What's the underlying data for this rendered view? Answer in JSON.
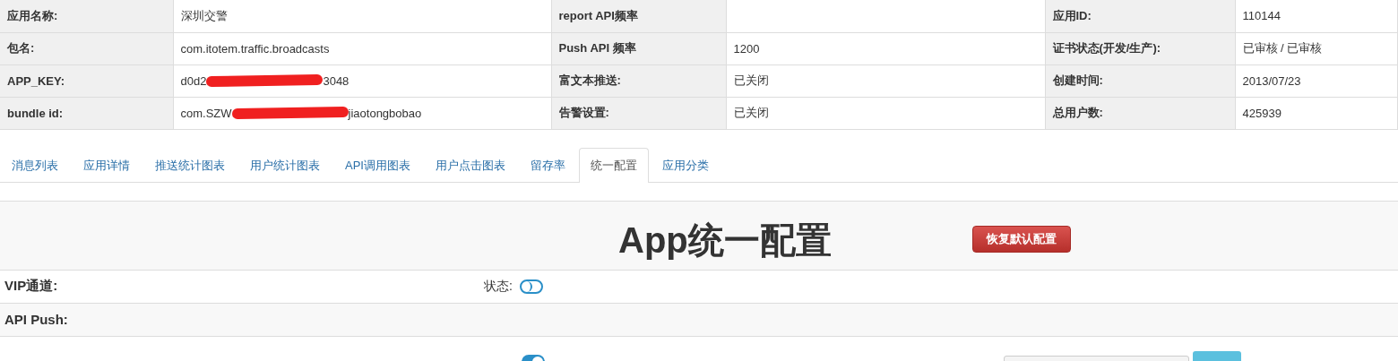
{
  "info_table": {
    "rows": [
      {
        "cells": [
          {
            "label": "应用名称:",
            "value": "深圳交警"
          },
          {
            "label": "report API频率"
          },
          {
            "label": "应用ID:",
            "value": "110144"
          }
        ]
      },
      {
        "cells": [
          {
            "label": "包名:",
            "value": "com.itotem.traffic.broadcasts"
          },
          {
            "label": "Push API 频率",
            "value": "1200"
          },
          {
            "label": "证书状态(开发/生产):",
            "value": "已审核 / 已审核"
          }
        ]
      },
      {
        "cells": [
          {
            "label": "APP_KEY:",
            "value": "d0d2",
            "value_end": "3048",
            "redacted": true
          },
          {
            "label": "富文本推送:",
            "value": "已关闭"
          },
          {
            "label": "创建时间:",
            "value": "2013/07/23"
          }
        ]
      },
      {
        "cells": [
          {
            "label": "bundle id:",
            "value": "com.SZW",
            "value_end": "jiaotongbobao",
            "redacted": true
          },
          {
            "label": "告警设置:",
            "value": "已关闭"
          },
          {
            "label": "总用户数:",
            "value": "425939"
          }
        ]
      }
    ]
  },
  "tabs": [
    {
      "label": "消息列表",
      "selected": false
    },
    {
      "label": "应用详情",
      "selected": false
    },
    {
      "label": "推送统计图表",
      "selected": false
    },
    {
      "label": "用户统计图表",
      "selected": false
    },
    {
      "label": "API调用图表",
      "selected": false
    },
    {
      "label": "用户点击图表",
      "selected": false
    },
    {
      "label": "留存率",
      "selected": false
    },
    {
      "label": "统一配置",
      "selected": true
    },
    {
      "label": "应用分类",
      "selected": false
    }
  ],
  "config": {
    "title": "App统一配置",
    "reset_button": "恢复默认配置",
    "rows": [
      {
        "label": "VIP通道:",
        "status_label": "状态:",
        "toggle_on": false
      },
      {
        "label": "API Push:"
      }
    ],
    "partial_row": {
      "toggle_on": true
    }
  }
}
